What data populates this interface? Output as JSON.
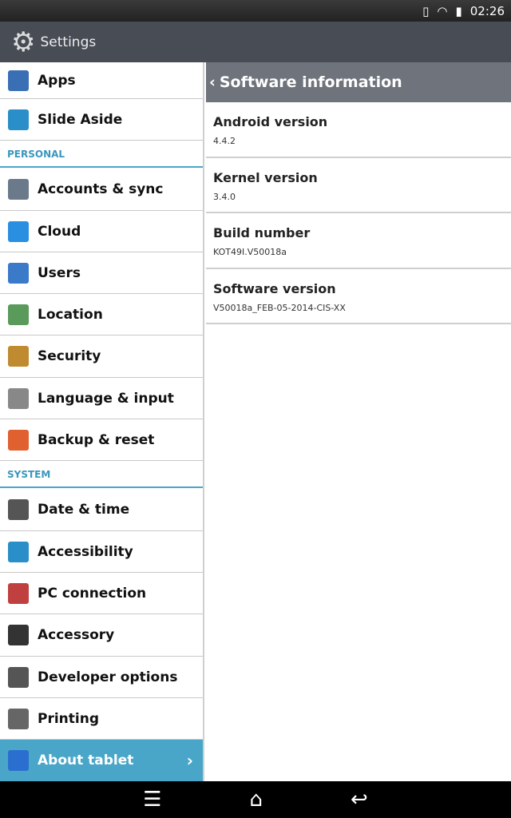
{
  "status": {
    "time": "02:26",
    "icons": [
      "vibrate-icon",
      "wifi-icon",
      "battery-icon"
    ]
  },
  "actionbar": {
    "title": "Settings",
    "icon": "gear-icon"
  },
  "sidebar": {
    "items_top": [
      {
        "label": "Apps",
        "color": "#3a6fb5"
      },
      {
        "label": "Slide Aside",
        "color": "#2a8fc8"
      }
    ],
    "personal_header": "PERSONAL",
    "personal": [
      {
        "label": "Accounts & sync",
        "color": "#6a7a8a"
      },
      {
        "label": "Cloud",
        "color": "#2a8fe0"
      },
      {
        "label": "Users",
        "color": "#3a7ac8"
      },
      {
        "label": "Location",
        "color": "#5a9a5a"
      },
      {
        "label": "Security",
        "color": "#c08a30"
      },
      {
        "label": "Language & input",
        "color": "#888888"
      },
      {
        "label": "Backup & reset",
        "color": "#e06030"
      }
    ],
    "system_header": "SYSTEM",
    "system": [
      {
        "label": "Date & time",
        "color": "#555555"
      },
      {
        "label": "Accessibility",
        "color": "#2a8fc8"
      },
      {
        "label": "PC connection",
        "color": "#c04040"
      },
      {
        "label": "Accessory",
        "color": "#333333"
      },
      {
        "label": "Developer options",
        "color": "#555555"
      },
      {
        "label": "Printing",
        "color": "#666666"
      },
      {
        "label": "About tablet",
        "color": "#2a6fd0"
      }
    ],
    "selected": "About tablet"
  },
  "detail": {
    "title": "Software information",
    "rows": [
      {
        "title": "Android version",
        "value": "4.4.2"
      },
      {
        "title": "Kernel version",
        "value": "3.4.0"
      },
      {
        "title": "Build number",
        "value": "KOT49I.V50018a"
      },
      {
        "title": "Software version",
        "value": "V50018a_FEB-05-2014-CIS-XX"
      }
    ]
  },
  "accent": "#4aa6c8"
}
